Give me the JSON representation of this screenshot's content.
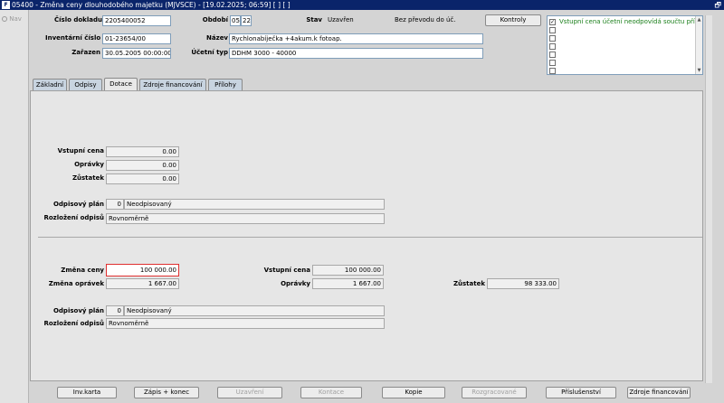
{
  "window": {
    "title": "05400 - Změna ceny dlouhodobého majetku (MJVSCE) - [19.02.2025; 06:59]  [ ]  [ ]",
    "icon_label": "F",
    "restore_glyph": "🗗"
  },
  "left_nav": {
    "label": "Nav",
    "icon": "circle-dot-icon"
  },
  "header": {
    "cislo_dokladu_label": "Číslo dokladu",
    "cislo_dokladu_value": "2205400052",
    "obdobi_label": "Období",
    "obdobi_month": "05",
    "obdobi_year": "22",
    "stav_label": "Stav",
    "stav_value": "Uzavřen",
    "prevod_text": "Bez převodu do úč.",
    "kontroly_button": "Kontroly",
    "inventarni_label": "Inventární číslo",
    "inventarni_value": "01-23654/00",
    "nazev_label": "Název",
    "nazev_value": "Rychlonabíječka +4akum.k fotoap.",
    "zarazen_label": "Zařazen",
    "zarazen_value": "30.05.2005 00:00:00",
    "ucetni_typ_label": "Účetní typ",
    "ucetni_typ_value": "DDHM 3000 - 40000"
  },
  "messages": [
    {
      "checked": true,
      "text": "Vstupní cena účetní neodpovídá součtu příp"
    },
    {
      "checked": false,
      "text": ""
    },
    {
      "checked": false,
      "text": ""
    },
    {
      "checked": false,
      "text": ""
    },
    {
      "checked": false,
      "text": ""
    },
    {
      "checked": false,
      "text": ""
    },
    {
      "checked": false,
      "text": ""
    }
  ],
  "messages_check_glyph": "✓",
  "scroll_glyphs": {
    "up": "▲",
    "down": "▼"
  },
  "tabs": [
    "Základní",
    "Odpisy",
    "Dotace",
    "Zdroje financování",
    "Přílohy"
  ],
  "active_tab": "Dotace",
  "top_section": {
    "vstupni_cena_label": "Vstupní cena",
    "vstupni_cena_value": "0.00",
    "opravky_label": "Oprávky",
    "opravky_value": "0.00",
    "zustatek_label": "Zůstatek",
    "zustatek_value": "0.00",
    "odpisovy_plan_label": "Odpisový plán",
    "odpisovy_plan_code": "0",
    "odpisovy_plan_value": "Neodpisovaný",
    "rozlozeni_label": "Rozložení odpisů",
    "rozlozeni_value": "Rovnoměrně"
  },
  "bottom_section": {
    "zmena_ceny_label": "Změna ceny",
    "zmena_ceny_value": "100 000.00",
    "zmena_opravek_label": "Změna oprávek",
    "zmena_opravek_value": "1 667.00",
    "vstupni_cena_label": "Vstupní cena",
    "vstupni_cena_value": "100 000.00",
    "opravky_label": "Oprávky",
    "opravky_value": "1 667.00",
    "zustatek_label": "Zůstatek",
    "zustatek_value": "98 333.00",
    "odpisovy_plan_label": "Odpisový plán",
    "odpisovy_plan_code": "0",
    "odpisovy_plan_value": "Neodpisovaný",
    "rozlozeni_label": "Rozložení odpisů",
    "rozlozeni_value": "Rovnoměrně"
  },
  "buttons": {
    "inv_karta": "Inv.karta",
    "zapis_konec": "Zápis + konec",
    "uzavreni": "Uzavření",
    "kontace": "Kontace",
    "kopie": "Kopie",
    "rozgracovane": "Rozgracované",
    "prislusenstvi": "Příslušenství",
    "zdroje_financovani": "Zdroje financování"
  },
  "colors": {
    "titlebar": "#0a246a",
    "message_text": "#1a7f1a",
    "focus_border": "#e03030",
    "tab_inactive": "#c8d4e0"
  }
}
